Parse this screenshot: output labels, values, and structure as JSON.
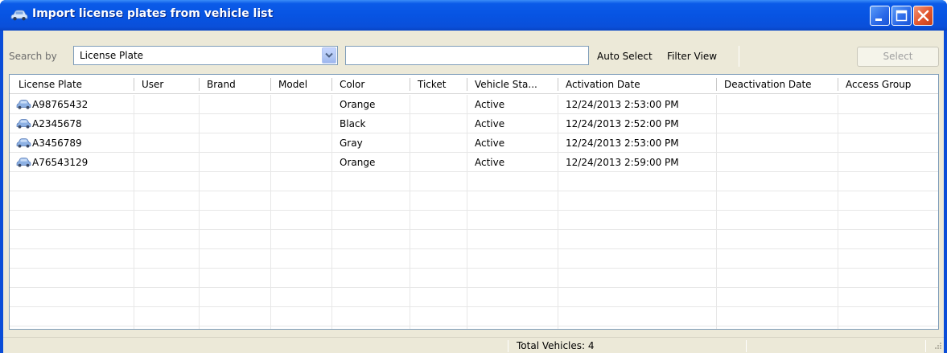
{
  "window": {
    "title": "Import license plates from vehicle list",
    "colors": {
      "titlebar": "#0754e3",
      "close": "#e2552c",
      "client": "#ece9d8"
    }
  },
  "toolbar": {
    "search_by_label": "Search by",
    "search_by_value": "License Plate",
    "search_text": "",
    "auto_select_label": "Auto Select",
    "filter_view_label": "Filter View",
    "select_label": "Select"
  },
  "grid": {
    "columns": [
      "License Plate",
      "User",
      "Brand",
      "Model",
      "Color",
      "Ticket",
      "Vehicle Sta...",
      "Activation Date",
      "Deactivation Date",
      "Access Group"
    ],
    "rows": [
      {
        "plate": "A98765432",
        "user": "",
        "brand": "",
        "model": "",
        "color": "Orange",
        "ticket": "",
        "status": "Active",
        "activation": "12/24/2013 2:53:00 PM",
        "deactivation": "",
        "access_group": ""
      },
      {
        "plate": "A2345678",
        "user": "",
        "brand": "",
        "model": "",
        "color": "Black",
        "ticket": "",
        "status": "Active",
        "activation": "12/24/2013 2:52:00 PM",
        "deactivation": "",
        "access_group": ""
      },
      {
        "plate": "A3456789",
        "user": "",
        "brand": "",
        "model": "",
        "color": "Gray",
        "ticket": "",
        "status": "Active",
        "activation": "12/24/2013 2:53:00 PM",
        "deactivation": "",
        "access_group": ""
      },
      {
        "plate": "A76543129",
        "user": "",
        "brand": "",
        "model": "",
        "color": "Orange",
        "ticket": "",
        "status": "Active",
        "activation": "12/24/2013 2:59:00 PM",
        "deactivation": "",
        "access_group": ""
      }
    ],
    "row_icon": "car-icon"
  },
  "statusbar": {
    "total_text": "Total Vehicles: 4"
  }
}
